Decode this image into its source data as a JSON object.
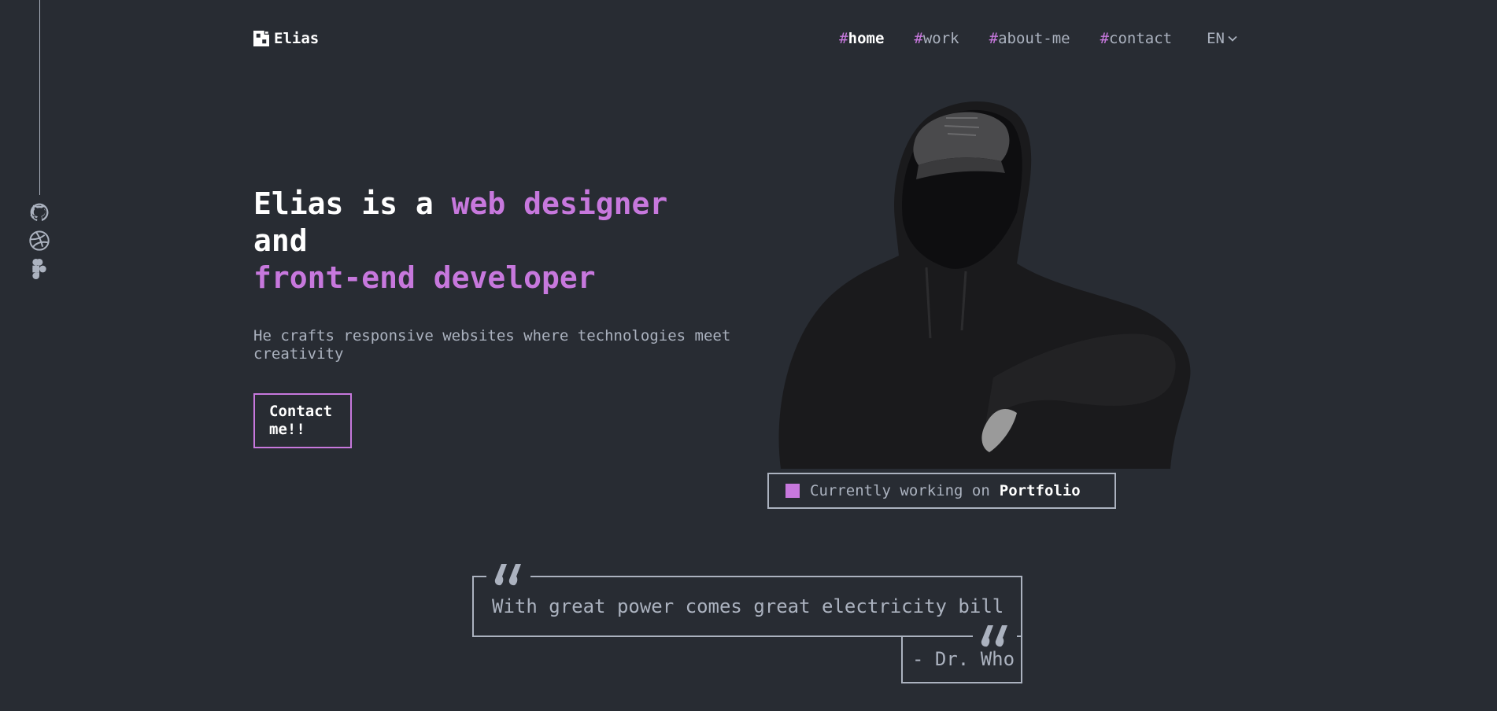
{
  "header": {
    "logo_text": "Elias",
    "nav": [
      {
        "hash": "#",
        "label": "home",
        "active": true
      },
      {
        "hash": "#",
        "label": "work",
        "active": false
      },
      {
        "hash": "#",
        "label": "about-me",
        "active": false
      },
      {
        "hash": "#",
        "label": "contact",
        "active": false
      }
    ],
    "language": "EN"
  },
  "sidebar": {
    "icons": [
      "github-icon",
      "dribbble-icon",
      "figma-icon"
    ]
  },
  "hero": {
    "title_part1": "Elias is a ",
    "title_accent1": "web designer",
    "title_part2": "and",
    "title_accent2": "front-end developer",
    "subtitle": "He crafts responsive websites where technologies meet creativity",
    "button_label": "Contact me!!"
  },
  "status": {
    "prefix": "Currently working on",
    "project": "Portfolio"
  },
  "quote": {
    "text": "With great power comes great electricity bill",
    "author": "- Dr. Who"
  },
  "colors": {
    "background": "#282c33",
    "accent": "#c778dd",
    "text": "#abb2bf",
    "white": "#ffffff"
  }
}
